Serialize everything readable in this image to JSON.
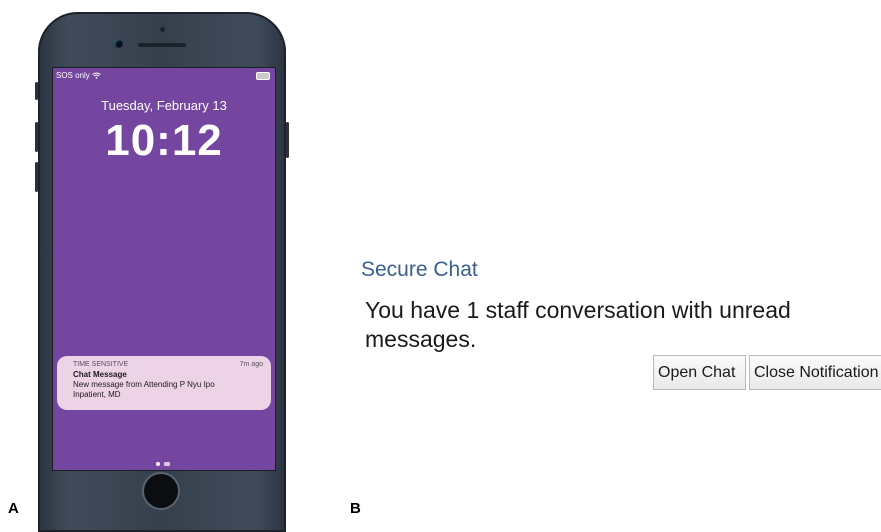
{
  "panel_a": {
    "label": "A",
    "status": {
      "carrier": "SOS only",
      "wifi_icon": "wifi-icon",
      "battery_icon": "battery-icon"
    },
    "lock_screen": {
      "date": "Tuesday, February 13",
      "time": "10:12"
    },
    "notification": {
      "category": "TIME SENSITIVE",
      "age": "7m ago",
      "title": "Chat Message",
      "body": "New message from Attending P Nyu Ipo Inpatient, MD"
    }
  },
  "panel_b": {
    "label": "B",
    "title": "Secure Chat",
    "message": "You have 1 staff conversation with unread messages.",
    "open_label": "Open Chat",
    "close_label": "Close Notification"
  },
  "colors": {
    "lock_screen_bg": "#7546a0",
    "notification_bg": "#ecd3e6",
    "chat_title": "#3a5f8e"
  }
}
